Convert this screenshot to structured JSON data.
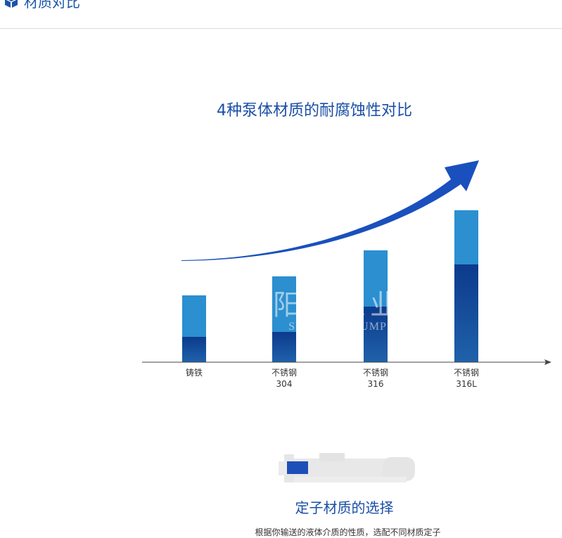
{
  "header": {
    "title": "材质对比",
    "icon": "cube-icon",
    "accent": "#1b54a8"
  },
  "watermark": {
    "cn": "阳光泵业",
    "en": "SUNSHINE PUMP"
  },
  "chart_data": {
    "type": "bar",
    "title": "4种泵体材质的耐腐蚀性对比",
    "categories": [
      [
        "铸铁"
      ],
      [
        "不锈钢",
        "304"
      ],
      [
        "不锈钢",
        "316"
      ],
      [
        "不锈钢",
        "316L"
      ]
    ],
    "values": [
      95,
      122,
      159,
      216
    ],
    "segments_dark": [
      36,
      43,
      79,
      139
    ],
    "xlabel": "",
    "ylabel": "",
    "ylim": [
      0,
      230
    ],
    "grid": false,
    "legend": "none",
    "colors": {
      "bar_light": "#2b8fd0",
      "bar_dark": "#0d3f8f",
      "arrow": "#1a50bd",
      "axis": "#444444"
    }
  },
  "section2": {
    "title": "定子材质的选择",
    "desc": "根据你输送的液体介质的性质，选配不同材质定子",
    "icon": "screw-pump-icon"
  }
}
